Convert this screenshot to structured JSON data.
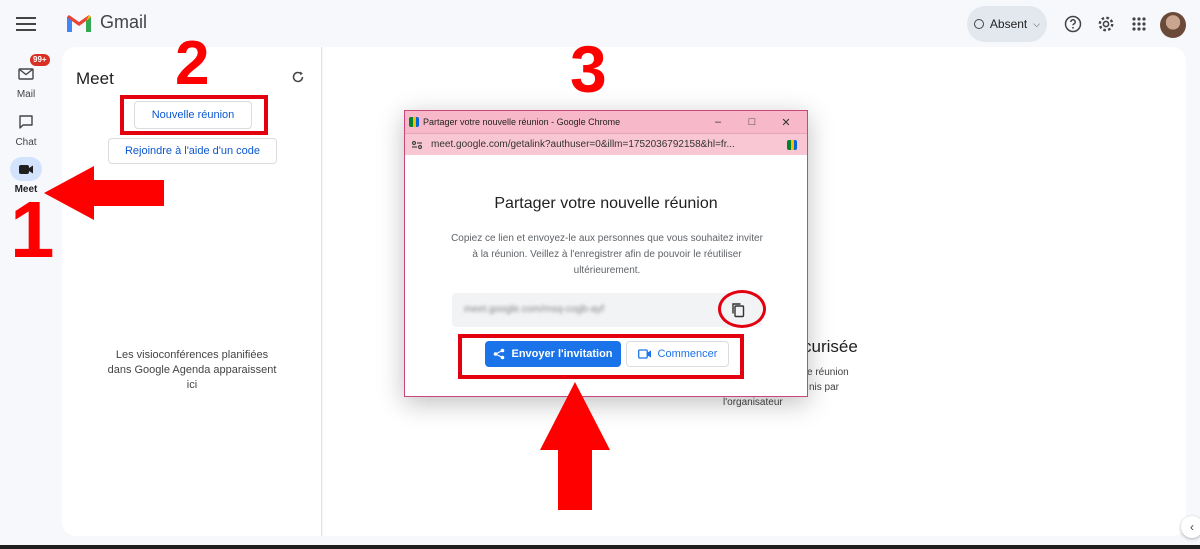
{
  "app": {
    "name": "Gmail"
  },
  "header": {
    "status_label": "Absent"
  },
  "rail": {
    "items": [
      {
        "label": "Mail",
        "badge": "99+"
      },
      {
        "label": "Chat"
      },
      {
        "label": "Meet"
      }
    ]
  },
  "meet_panel": {
    "title": "Meet",
    "new_meeting_label": "Nouvelle réunion",
    "join_label": "Rejoindre à l'aide d'un code",
    "empty_message": "Les visioconférences planifiées dans Google Agenda apparaissent ici"
  },
  "background_content": {
    "title_fragment": "curisée",
    "line1": "e réunion",
    "line2": "nis par",
    "line3": "l'organisateur"
  },
  "popup": {
    "window_title": "Partager votre nouvelle réunion - Google Chrome",
    "url": "meet.google.com/getalink?authuser=0&illm=1752036792158&hl=fr...",
    "heading": "Partager votre nouvelle réunion",
    "description": "Copiez ce lien et envoyez-le aux personnes que vous souhaitez inviter à la réunion. Veillez à l'enregistrer afin de pouvoir le réutiliser ultérieurement.",
    "link": "meet.google.com/msq-cogb-ayf",
    "send_invite_label": "Envoyer l'invitation",
    "start_label": "Commencer"
  },
  "annotations": {
    "step1": "1",
    "step2": "2",
    "step3": "3"
  },
  "colors": {
    "annotation_red": "#e3000f",
    "primary_blue": "#1a73e8",
    "popup_titlebar": "#f7b8c9"
  }
}
